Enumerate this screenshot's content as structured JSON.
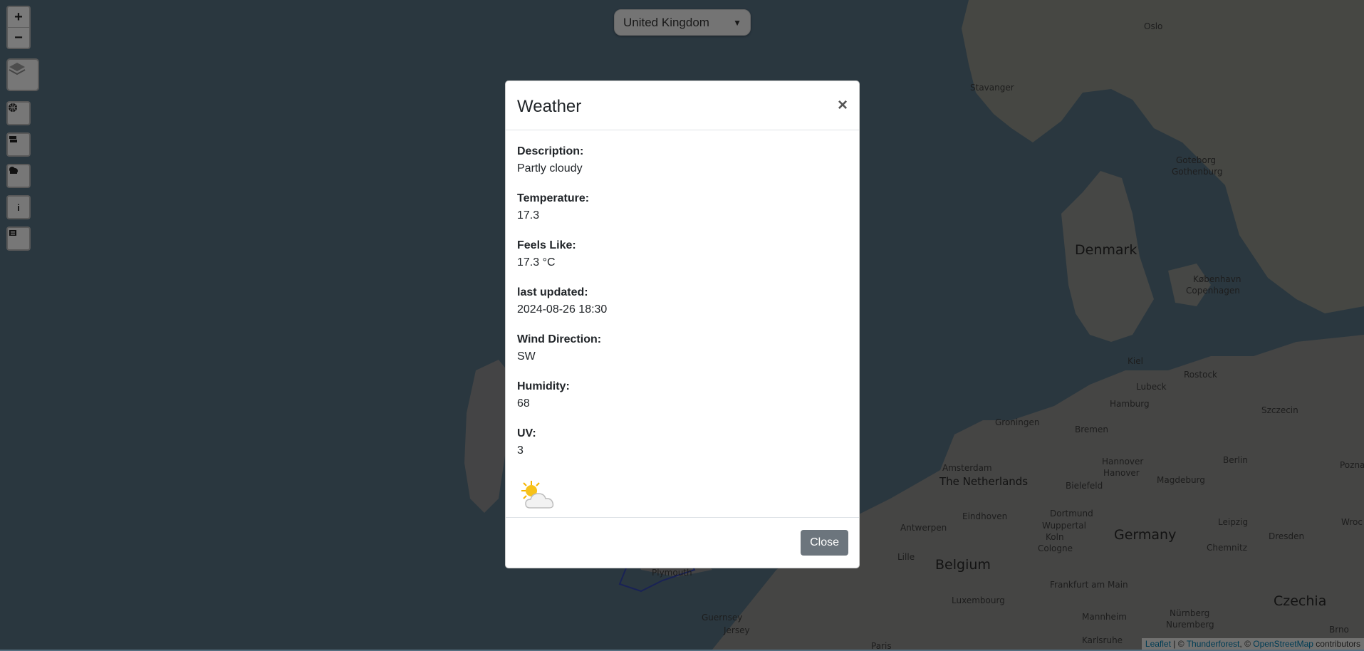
{
  "country_select": {
    "value": "United Kingdom"
  },
  "map_labels": {
    "oslo": "Oslo",
    "stavanger": "Stavanger",
    "goteborg": "Goteborg",
    "gothenburg": "Gothenburg",
    "denmark": "Denmark",
    "kobenhavn": "København",
    "copenhagen": "Copenhagen",
    "kiel": "Kiel",
    "rostock": "Rostock",
    "lubeck": "Lubeck",
    "hamburg": "Hamburg",
    "szczecin": "Szczecin",
    "groningen": "Groningen",
    "bremen": "Bremen",
    "amsterdam": "Amsterdam",
    "netherlands": "The Netherlands",
    "hannover1": "Hannover",
    "hannover2": "Hanover",
    "berlin": "Berlin",
    "bielefeld": "Bielefeld",
    "magdeburg": "Magdeburg",
    "poznan": "Pozna",
    "eindhoven": "Eindhoven",
    "dortmund": "Dortmund",
    "wuppertal": "Wuppertal",
    "antwerpen": "Antwerpen",
    "koln": "Koln",
    "cologne": "Cologne",
    "germany": "Germany",
    "leipzig": "Leipzig",
    "dresden": "Dresden",
    "chemnitz": "Chemnitz",
    "wroclaw": "Wroc",
    "lille": "Lille",
    "belgium": "Belgium",
    "frankfurt": "Frankfurt am Main",
    "luxembourg": "Luxembourg",
    "mannheim": "Mannheim",
    "nurnberg": "Nürnberg",
    "nuremberg": "Nuremberg",
    "czechia": "Czechia",
    "brno": "Brno",
    "karlsruhe": "Karlsruhe",
    "paris": "Paris",
    "guernsey": "Guernsey",
    "jersey": "Jersey",
    "plymouth": "Plymouth"
  },
  "attribution": {
    "leaflet": "Leaflet",
    "sep1": " | © ",
    "thunderforest": "Thunderforest",
    "sep2": ", © ",
    "osm": "OpenStreetMap",
    "contributors": " contributors"
  },
  "modal": {
    "title": "Weather",
    "close_symbol": "×",
    "fields": [
      {
        "label": "Description:",
        "value": "Partly cloudy"
      },
      {
        "label": "Temperature:",
        "value": "17.3"
      },
      {
        "label": "Feels Like:",
        "value": "17.3 °C"
      },
      {
        "label": "last updated:",
        "value": "2024-08-26 18:30"
      },
      {
        "label": "Wind Direction:",
        "value": "SW"
      },
      {
        "label": "Humidity:",
        "value": "68"
      },
      {
        "label": "UV:",
        "value": "3"
      }
    ],
    "weather_icon": "partly-cloudy-icon",
    "close_button": "Close"
  },
  "icons": {
    "zoom_in": "+",
    "zoom_out": "−",
    "globe": "globe-icon",
    "layers": "layers-icon",
    "currency": "money-icon",
    "weather": "cloud-icon",
    "info": "i",
    "news": "newspaper-icon"
  },
  "colors": {
    "sea": "#546e7f",
    "land": "#8c8c8a",
    "button_secondary": "#6c757d"
  }
}
